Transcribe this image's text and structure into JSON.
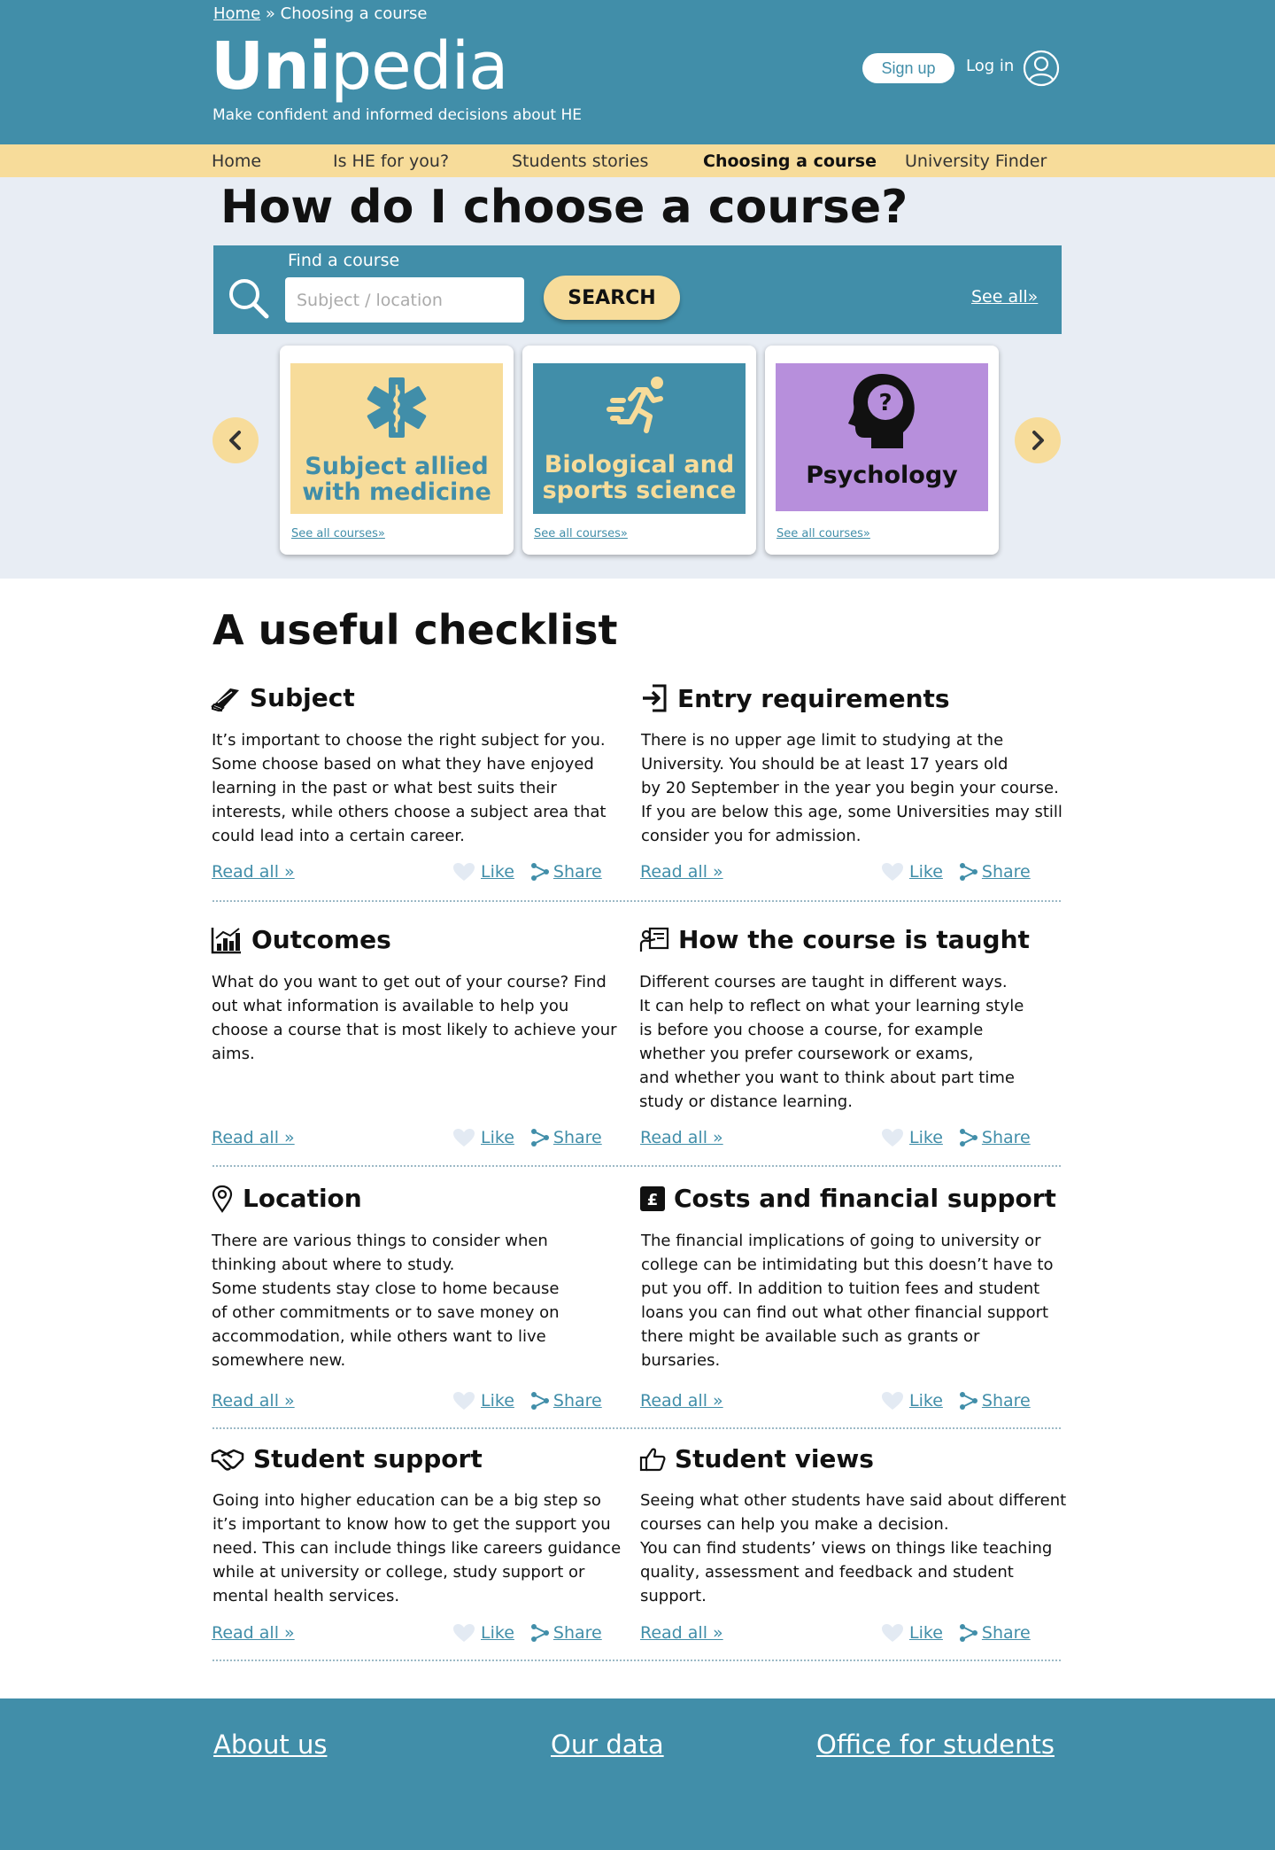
{
  "header": {
    "breadcrumb_home": "Home",
    "breadcrumb_separator": "»",
    "breadcrumb_current": "Choosing a course",
    "logo_bold": "Uni",
    "logo_light": "pedia",
    "tagline": "Make confident and informed decisions about HE",
    "signup": "Sign up",
    "login": "Log in"
  },
  "nav": {
    "items": [
      "Home",
      "Is HE for you?",
      "Students stories",
      "Choosing a course",
      "University Finder"
    ],
    "active": "Choosing a course"
  },
  "hero": {
    "title": "How do I choose a course?",
    "find_label": "Find a course",
    "search_placeholder": "Subject / location",
    "search_button": "SEARCH",
    "see_all": "See all»"
  },
  "cards": [
    {
      "title": "Subject allied with medicine",
      "link": "See all courses»",
      "icon": "medical-star-icon",
      "bg": "#f7dc9a",
      "fg": "#418ea9"
    },
    {
      "title": "Biological and sports science",
      "link": "See all courses»",
      "icon": "runner-icon",
      "bg": "#418ea9",
      "fg": "#f7dc9a"
    },
    {
      "title": "Psychology",
      "link": "See all courses»",
      "icon": "head-question-icon",
      "bg": "#b78fdc",
      "fg": "#111111"
    }
  ],
  "checklist": {
    "title": "A useful checklist",
    "read_all": "Read all »",
    "like": "Like",
    "share": "Share",
    "items": [
      {
        "title": "Subject",
        "icon": "book-icon",
        "lines": [
          "It’s important to choose the right subject for you.",
          "Some choose based on what they have enjoyed",
          "learning in the past or what best suits their",
          "interests, while others choose a subject area that",
          "could lead into a certain career."
        ]
      },
      {
        "title": "Entry requirements",
        "icon": "sign-in-icon",
        "lines": [
          "There is no upper age limit to studying at the",
          "University. You should be at least 17 years old",
          "by 20 September in the year you begin your course.",
          "If you are below this age, some Universities may still",
          "consider you for admission."
        ]
      },
      {
        "title": "Outcomes",
        "icon": "bar-chart-icon",
        "lines": [
          "What do you want to get out of your course? Find",
          "out what information is available to help you",
          "choose a course that is most likely to achieve your",
          "aims."
        ]
      },
      {
        "title": "How the course is taught",
        "icon": "teacher-icon",
        "lines": [
          "Different courses are taught in different ways.",
          "It can help to reflect on what your learning style",
          "is before you choose a course, for example",
          "whether you prefer coursework or exams,",
          "and whether you want to think about part time",
          "study or distance learning."
        ]
      },
      {
        "title": "Location",
        "icon": "map-pin-icon",
        "lines": [
          "There are various things to consider when",
          "thinking about where to study.",
          "Some students stay close to home because",
          "of other commitments or to save money on",
          "accommodation, while others want to live",
          "somewhere new."
        ]
      },
      {
        "title": "Costs and financial support",
        "icon": "pound-icon",
        "lines": [
          "The financial implications of going to university or",
          "college can be intimidating but this doesn’t have to",
          "put you off. In addition to tuition fees and student",
          "loans you can find out what other financial support",
          "there might be available such as grants or",
          "bursaries."
        ]
      },
      {
        "title": "Student support",
        "icon": "handshake-icon",
        "lines": [
          "Going into higher education can be a big step so",
          "it’s important to know how to get the support you",
          "need. This can include things like careers guidance",
          "while at university or college, study support or",
          "mental health services."
        ]
      },
      {
        "title": "Student views",
        "icon": "thumbs-up-icon",
        "lines": [
          "Seeing what other students have said about different",
          "courses can help you make a decision.",
          "You can find students’ views on things like teaching",
          "quality, assessment and feedback and student",
          "support."
        ]
      }
    ]
  },
  "footer": {
    "links": [
      "About us",
      "Our data",
      "Office for students"
    ]
  },
  "colors": {
    "brand_blue": "#418ea9",
    "accent_yellow": "#f7dc9a",
    "hero_bg": "#e8edf4",
    "psychology_purple": "#b78fdc"
  }
}
